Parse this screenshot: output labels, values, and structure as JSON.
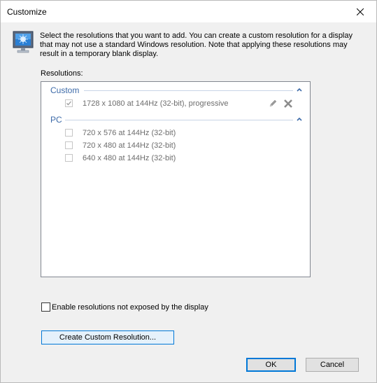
{
  "window": {
    "title": "Customize"
  },
  "intro_text": "Select the resolutions that you want to add. You can create a custom resolution for a display that may not use a standard Windows resolution. Note that applying these resolutions may result in a temporary blank display.",
  "resolutions_label": "Resolutions:",
  "groups": [
    {
      "title": "Custom",
      "items": [
        {
          "label": "1728 x 1080 at 144Hz (32-bit), progressive",
          "checked": true
        }
      ]
    },
    {
      "title": "PC",
      "items": [
        {
          "label": "720 x 576 at 144Hz (32-bit)",
          "checked": false
        },
        {
          "label": "720 x 480 at 144Hz (32-bit)",
          "checked": false
        },
        {
          "label": "640 x 480 at 144Hz (32-bit)",
          "checked": false
        }
      ]
    }
  ],
  "enable_option": {
    "label": "Enable resolutions not exposed by the display",
    "checked": false
  },
  "buttons": {
    "create_custom": "Create Custom Resolution...",
    "ok": "OK",
    "cancel": "Cancel"
  },
  "colors": {
    "accent": "#0078d7",
    "group_title": "#3c6aa8"
  }
}
